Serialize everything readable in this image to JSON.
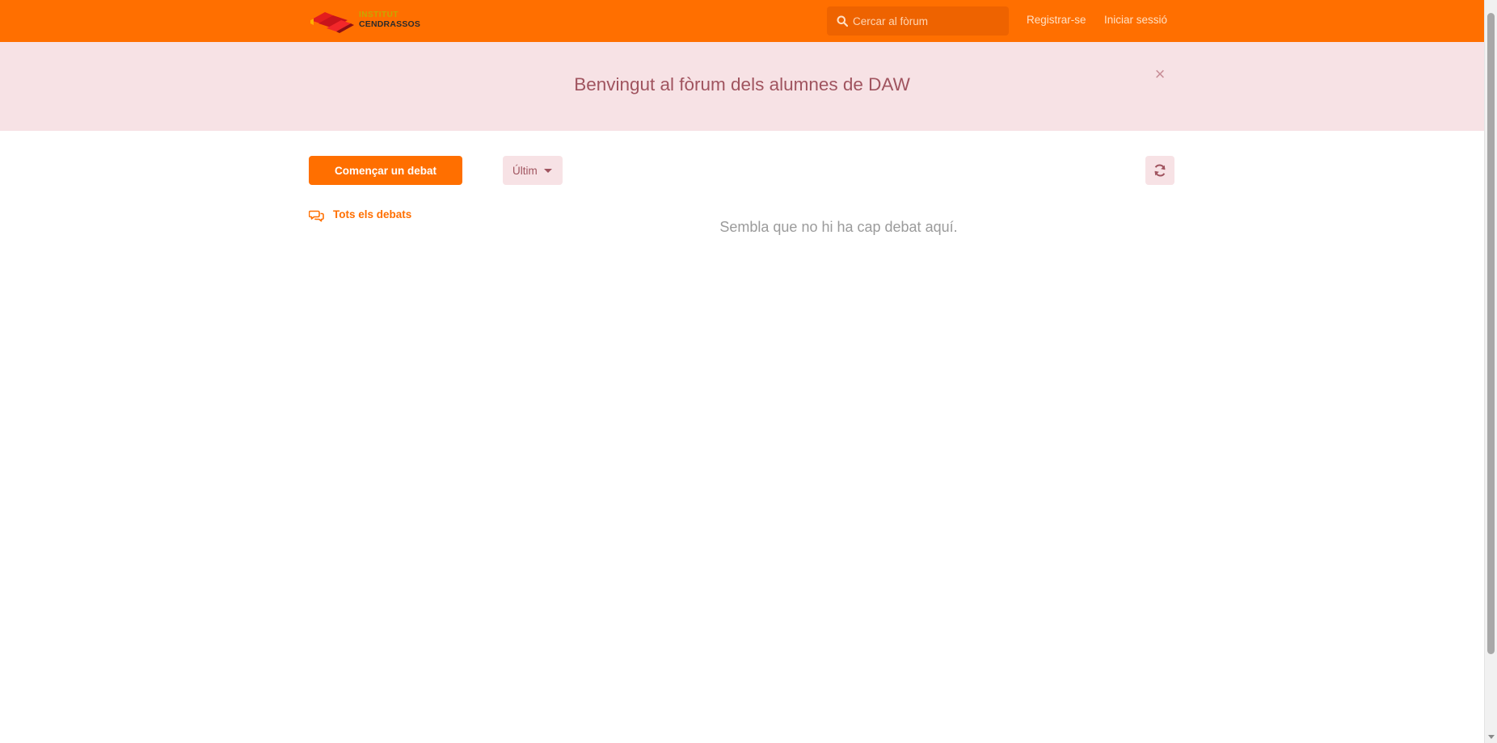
{
  "header": {
    "logo_brand_top": "INSTITUT",
    "logo_brand": "CENDRASSOS",
    "search": {
      "placeholder": "Cercar al fòrum",
      "value": ""
    },
    "links": {
      "register": "Registrar-se",
      "login": "Iniciar sessió"
    }
  },
  "banner": {
    "title": "Benvingut al fòrum dels alumnes de DAW",
    "close_glyph": "×"
  },
  "toolbar": {
    "start_button": "Començar un debat",
    "sort_label": "Últim"
  },
  "sidebar": {
    "all_discussions": "Tots els debats"
  },
  "main": {
    "empty_message": "Sembla que no hi ha cap debat aquí."
  },
  "colors": {
    "primary": "#ff6f00",
    "banner_bg": "#f7e2e5",
    "banner_text": "#a0545f",
    "muted_text": "#9b9b9b"
  },
  "icons": {
    "search": "search-icon",
    "close": "close-icon",
    "caret": "caret-down-icon",
    "refresh": "refresh-icon",
    "discussions": "comments-icon",
    "logo": "cendrassos-logo-icon"
  }
}
